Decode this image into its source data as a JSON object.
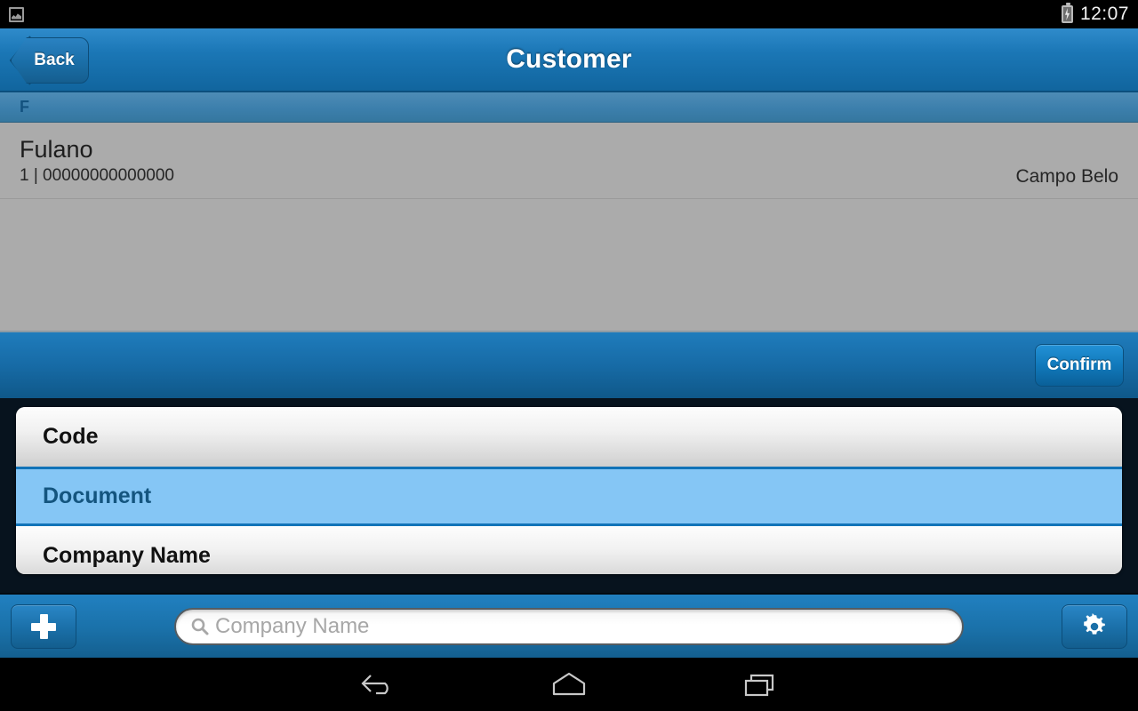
{
  "statusbar": {
    "screenshot_icon": "screenshot-icon",
    "battery_icon": "battery-charging-icon",
    "time": "12:07"
  },
  "titlebar": {
    "back_label": "Back",
    "title": "Customer"
  },
  "list": {
    "section_header": "F",
    "rows": [
      {
        "name": "Fulano",
        "detail": "1 | 00000000000000",
        "location": "Campo Belo"
      }
    ]
  },
  "actionbar": {
    "confirm_label": "Confirm"
  },
  "dropdown": {
    "items": [
      {
        "label": "Code",
        "selected": false
      },
      {
        "label": "Document",
        "selected": true
      },
      {
        "label": "Company Name",
        "selected": false
      }
    ]
  },
  "toolbar": {
    "add_label": "+",
    "add_icon": "plus-icon",
    "settings_icon": "gear-icon",
    "search": {
      "icon": "search-icon",
      "value": "",
      "placeholder": "Company Name"
    }
  },
  "navbar": {
    "back_icon": "android-back-icon",
    "home_icon": "android-home-icon",
    "recents_icon": "android-recents-icon"
  },
  "colors": {
    "accent_blue": "#1a71a9",
    "title_blue": "#1b77b6",
    "selected_row": "#85c6f5",
    "selected_text": "#14557f",
    "list_gray": "#ababab",
    "panel_dark": "#07131e"
  }
}
